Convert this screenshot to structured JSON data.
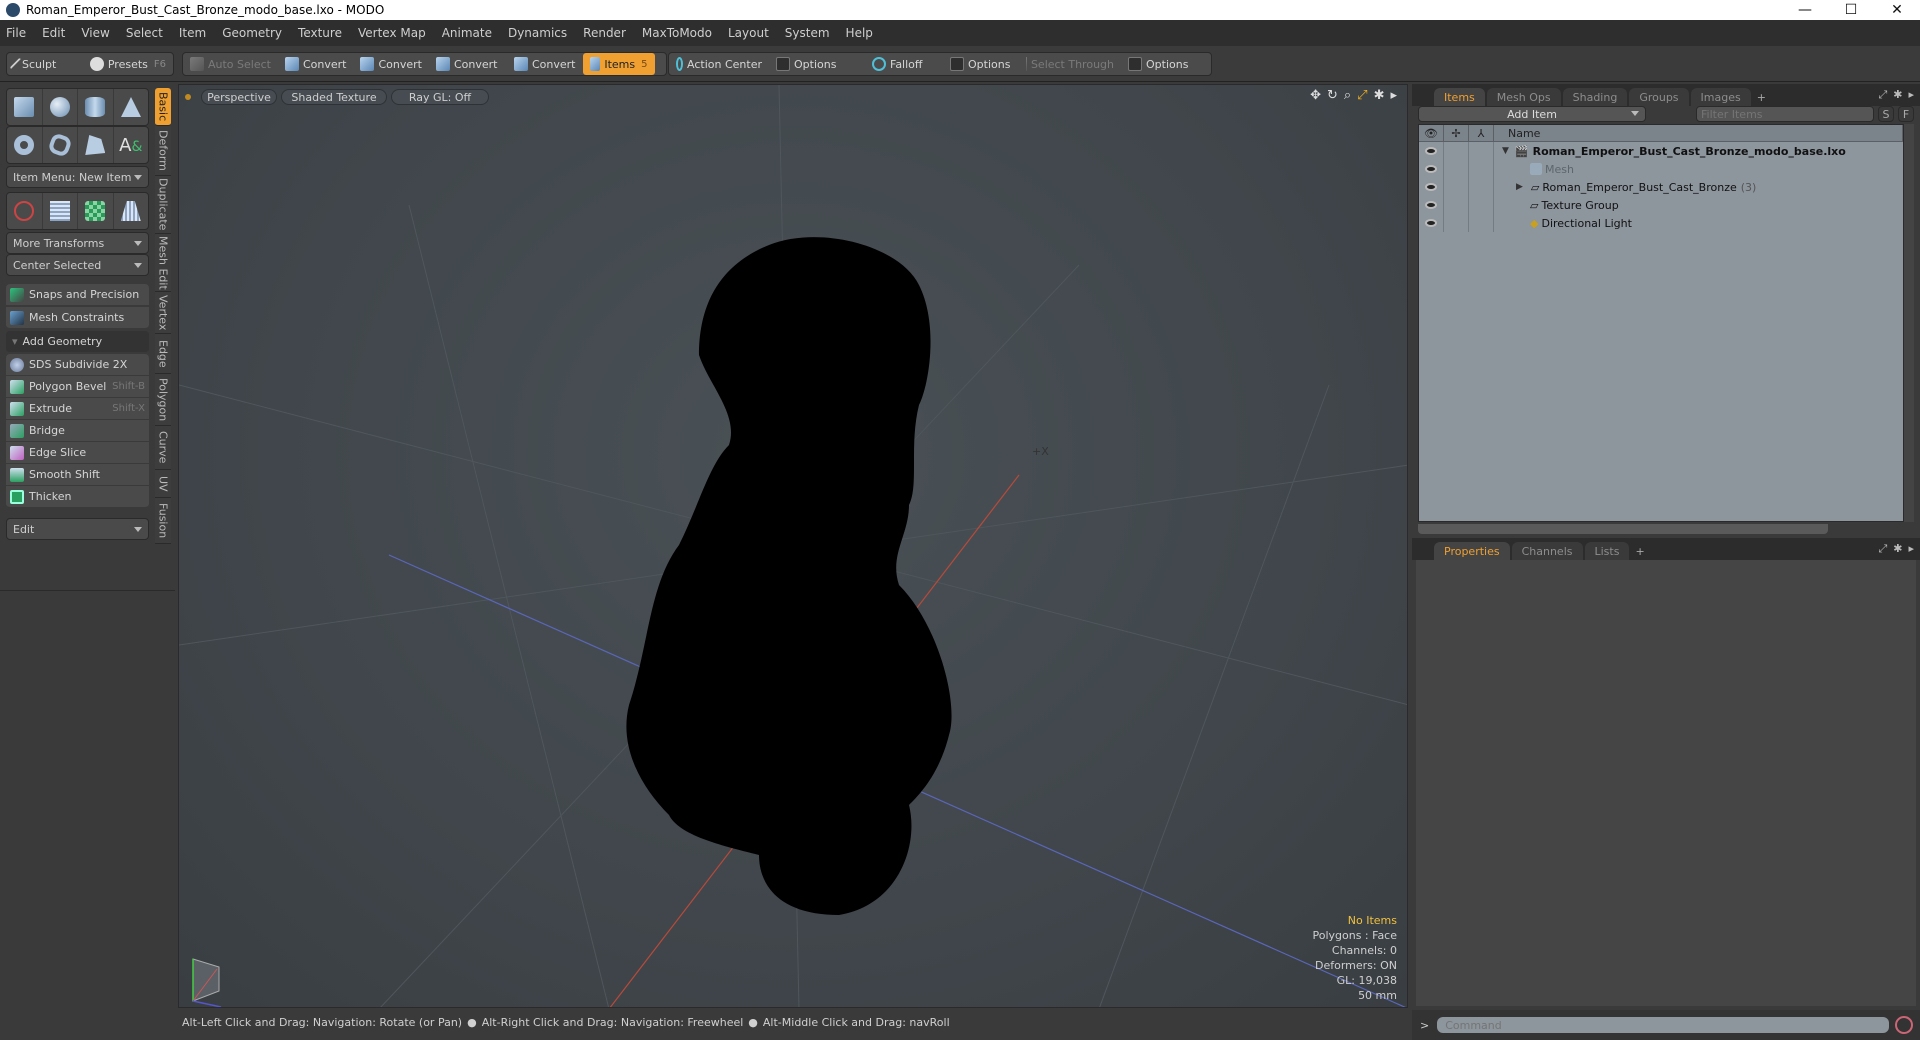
{
  "window": {
    "title": "Roman_Emperor_Bust_Cast_Bronze_modo_base.lxo - MODO",
    "minimize": "—",
    "maximize": "☐",
    "close": "✕"
  },
  "menu": [
    "File",
    "Edit",
    "View",
    "Select",
    "Item",
    "Geometry",
    "Texture",
    "Vertex Map",
    "Animate",
    "Dynamics",
    "Render",
    "MaxToModo",
    "Layout",
    "System",
    "Help"
  ],
  "toolbar": {
    "sculpt": "Sculpt",
    "presets": "Presets",
    "presets_key": "F6",
    "auto_select": "Auto Select",
    "convert1": "Convert",
    "convert2": "Convert",
    "convert3": "Convert",
    "convert4": "Convert",
    "items": "Items",
    "items_key": "5",
    "action_center": "Action Center",
    "options1": "Options",
    "falloff": "Falloff",
    "options2": "Options",
    "select_through": "Select Through",
    "options3": "Options"
  },
  "left": {
    "item_menu": "Item Menu: New Item",
    "more_transforms": "More Transforms",
    "center_selected": "Center Selected",
    "snaps": "Snaps and Precision",
    "mesh_constraints": "Mesh Constraints",
    "add_geometry": "Add Geometry",
    "tools": [
      {
        "label": "SDS Subdivide 2X",
        "shortcut": ""
      },
      {
        "label": "Polygon Bevel",
        "shortcut": "Shift-B"
      },
      {
        "label": "Extrude",
        "shortcut": "Shift-X"
      },
      {
        "label": "Bridge",
        "shortcut": ""
      },
      {
        "label": "Edge Slice",
        "shortcut": ""
      },
      {
        "label": "Smooth Shift",
        "shortcut": ""
      },
      {
        "label": "Thicken",
        "shortcut": ""
      }
    ],
    "edit_dropdown": "Edit",
    "vtabs": [
      "Basic",
      "Deform",
      "Duplicate",
      "Mesh Edit",
      "Vertex",
      "Edge",
      "Polygon",
      "Curve",
      "UV",
      "Fusion"
    ]
  },
  "viewport": {
    "view": "Perspective",
    "shading": "Shaded Texture",
    "raygl": "Ray GL: Off",
    "axis_label": "+X",
    "info": {
      "selection": "No Items",
      "polygons": "Polygons : Face",
      "channels": "Channels: 0",
      "deformers": "Deformers: ON",
      "gl": "GL: 19,038",
      "scale": "50 mm"
    }
  },
  "status": {
    "hint1": "Alt-Left Click and Drag: Navigation: Rotate (or Pan)",
    "hint2": "Alt-Right Click and Drag: Navigation: Freewheel",
    "hint3": "Alt-Middle Click and Drag: navRoll"
  },
  "right": {
    "tabs": [
      "Items",
      "Mesh Ops",
      "Shading",
      "Groups",
      "Images"
    ],
    "add_item": "Add Item",
    "filter_placeholder": "Filter Items",
    "s_btn": "S",
    "f_btn": "F",
    "col_name": "Name",
    "tree": [
      {
        "name": "Roman_Emperor_Bust_Cast_Bronze_modo_base.lxo",
        "count": ""
      },
      {
        "name": "Mesh",
        "count": ""
      },
      {
        "name": "Roman_Emperor_Bust_Cast_Bronze",
        "count": "(3)"
      },
      {
        "name": "Texture Group",
        "count": ""
      },
      {
        "name": "Directional Light",
        "count": ""
      }
    ],
    "bottom_tabs": [
      "Properties",
      "Channels",
      "Lists"
    ],
    "command_placeholder": "Command",
    "prompt": ">"
  },
  "colors": {
    "accent": "#f0a030",
    "info_highlight": "#f0c040"
  }
}
